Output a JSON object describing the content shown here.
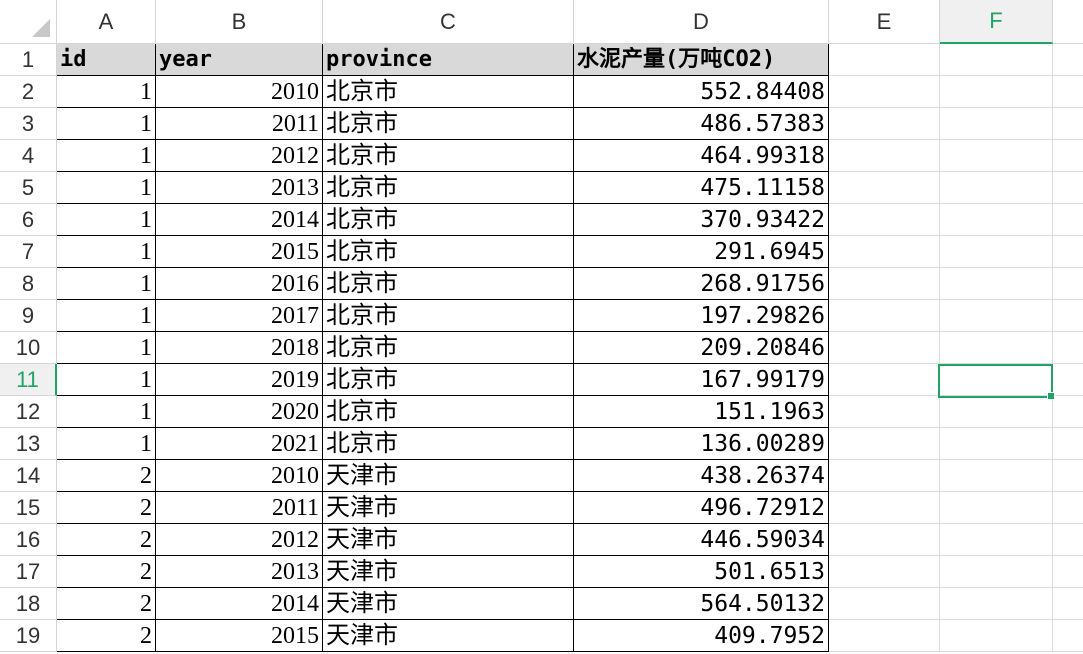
{
  "columns": [
    "A",
    "B",
    "C",
    "D",
    "E",
    "F"
  ],
  "active_column": "F",
  "active_row": "11",
  "header_row": {
    "row_number": "1",
    "id": "id",
    "year": "year",
    "province": "province",
    "cement": "水泥产量(万吨CO2)"
  },
  "rows": [
    {
      "row_number": "2",
      "id": "1",
      "year": "2010",
      "province": "北京市",
      "cement": "552.84408"
    },
    {
      "row_number": "3",
      "id": "1",
      "year": "2011",
      "province": "北京市",
      "cement": "486.57383"
    },
    {
      "row_number": "4",
      "id": "1",
      "year": "2012",
      "province": "北京市",
      "cement": "464.99318"
    },
    {
      "row_number": "5",
      "id": "1",
      "year": "2013",
      "province": "北京市",
      "cement": "475.11158"
    },
    {
      "row_number": "6",
      "id": "1",
      "year": "2014",
      "province": "北京市",
      "cement": "370.93422"
    },
    {
      "row_number": "7",
      "id": "1",
      "year": "2015",
      "province": "北京市",
      "cement": "291.6945"
    },
    {
      "row_number": "8",
      "id": "1",
      "year": "2016",
      "province": "北京市",
      "cement": "268.91756"
    },
    {
      "row_number": "9",
      "id": "1",
      "year": "2017",
      "province": "北京市",
      "cement": "197.29826"
    },
    {
      "row_number": "10",
      "id": "1",
      "year": "2018",
      "province": "北京市",
      "cement": "209.20846"
    },
    {
      "row_number": "11",
      "id": "1",
      "year": "2019",
      "province": "北京市",
      "cement": "167.99179"
    },
    {
      "row_number": "12",
      "id": "1",
      "year": "2020",
      "province": "北京市",
      "cement": "151.1963"
    },
    {
      "row_number": "13",
      "id": "1",
      "year": "2021",
      "province": "北京市",
      "cement": "136.00289"
    },
    {
      "row_number": "14",
      "id": "2",
      "year": "2010",
      "province": "天津市",
      "cement": "438.26374"
    },
    {
      "row_number": "15",
      "id": "2",
      "year": "2011",
      "province": "天津市",
      "cement": "496.72912"
    },
    {
      "row_number": "16",
      "id": "2",
      "year": "2012",
      "province": "天津市",
      "cement": "446.59034"
    },
    {
      "row_number": "17",
      "id": "2",
      "year": "2013",
      "province": "天津市",
      "cement": "501.6513"
    },
    {
      "row_number": "18",
      "id": "2",
      "year": "2014",
      "province": "天津市",
      "cement": "564.50132"
    },
    {
      "row_number": "19",
      "id": "2",
      "year": "2015",
      "province": "天津市",
      "cement": "409.7952"
    }
  ],
  "colors": {
    "accent": "#21a366",
    "header_fill": "#d9d9d9",
    "gridline": "#dcdcdc"
  }
}
